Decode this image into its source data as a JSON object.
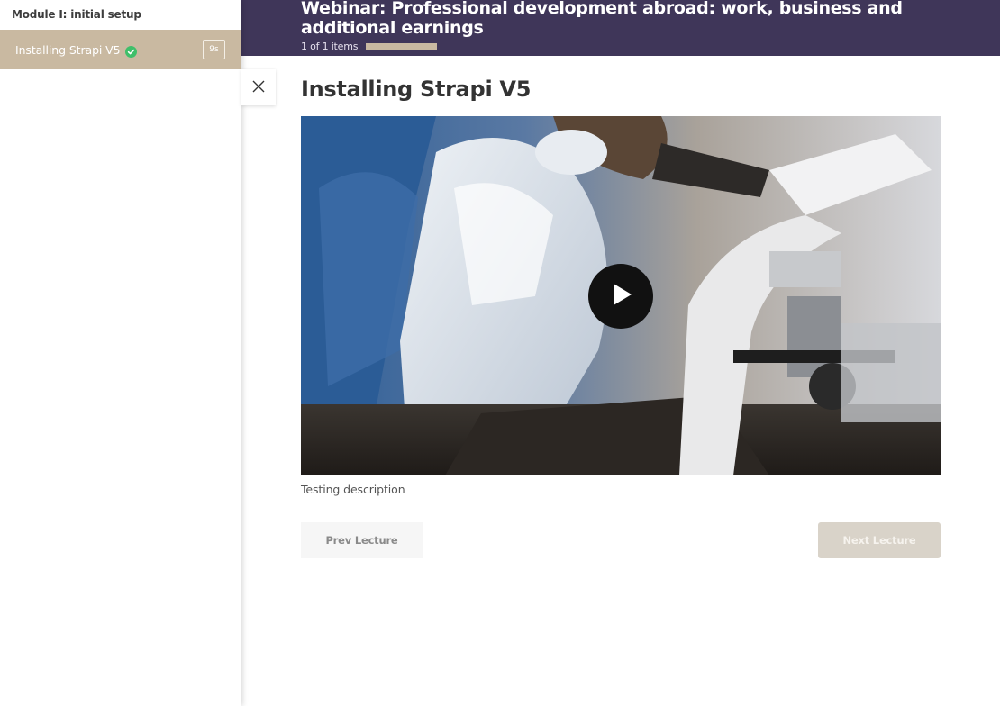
{
  "sidebar": {
    "module_title": "Module I: initial setup",
    "items": [
      {
        "label": "Installing Strapi V5",
        "duration": "9s",
        "completed": true,
        "icon": "check-circle-icon"
      }
    ]
  },
  "header": {
    "course_title": "Webinar: Professional development abroad: work, business and additional earnings",
    "progress_text": "1 of 1 items",
    "progress_value": 1.0
  },
  "lecture": {
    "title": "Installing Strapi V5",
    "description": "Testing description"
  },
  "navigation": {
    "prev_label": "Prev Lecture",
    "next_label": "Next Lecture"
  },
  "colors": {
    "header_bg": "#3f3659",
    "accent": "#c9b9a1",
    "check_green": "#3fbf6a"
  }
}
